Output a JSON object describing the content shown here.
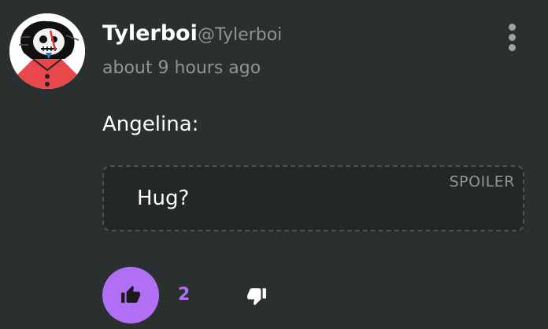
{
  "post": {
    "author_name": "Tylerboi",
    "author_handle": "@Tylerboi",
    "timestamp": "about 9 hours ago",
    "text": "Angelina:",
    "spoiler": {
      "label": "SPOILER",
      "text": "Hug?"
    }
  },
  "reactions": {
    "like_count": "2",
    "like_active": true
  },
  "icons": {
    "more": "more-vertical-icon",
    "like": "thumbs-up-icon",
    "dislike": "thumbs-down-icon"
  },
  "colors": {
    "background": "#2a2f30",
    "accent": "#b16ff5",
    "muted_text": "#8f9495",
    "spoiler_bg": "#232727"
  }
}
